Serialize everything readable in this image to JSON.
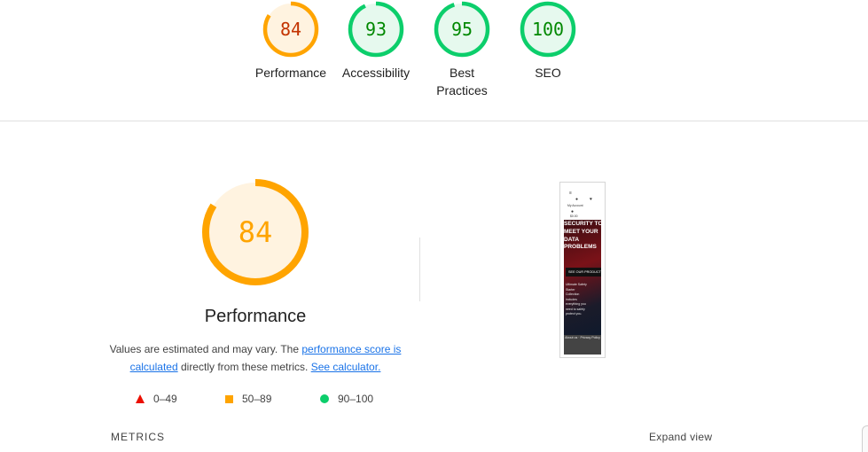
{
  "scores": [
    {
      "value": "84",
      "label": "Performance",
      "fraction": 0.84,
      "ring": "#ffa400",
      "fill": "#fff3e0",
      "text": "#c33300"
    },
    {
      "value": "93",
      "label": "Accessibility",
      "fraction": 0.93,
      "ring": "#0cce6b",
      "fill": "#e6f9ee",
      "text": "#008800"
    },
    {
      "value": "95",
      "label": "Best Practices",
      "fraction": 0.95,
      "ring": "#0cce6b",
      "fill": "#e6f9ee",
      "text": "#008800"
    },
    {
      "value": "100",
      "label": "SEO",
      "fraction": 1.0,
      "ring": "#0cce6b",
      "fill": "#e6f9ee",
      "text": "#008800"
    }
  ],
  "performance": {
    "score": "84",
    "fraction": 0.84,
    "ring": "#ffa400",
    "fill": "#fff3e0",
    "text": "#ffa400",
    "title": "Performance",
    "desc_prefix": "Values are estimated and may vary. The ",
    "link_score": "performance score is calculated",
    "desc_middle": " directly from these metrics. ",
    "link_calculator": "See calculator."
  },
  "legend": [
    {
      "icon": "triangle-icon",
      "range": "0–49",
      "color": "#eb0f00"
    },
    {
      "icon": "square-icon",
      "range": "50–89",
      "color": "#ffa400"
    },
    {
      "icon": "circle-icon",
      "range": "90–100",
      "color": "#0cce6b"
    }
  ],
  "screenshot": {
    "hero_text": "SECURITY TO MEET YOUR DATA PROBLEMS",
    "button": "SEE OUR PRODUCTS",
    "body": "Ultimate Safety Starter Collection includes everything you need to safely protect you.",
    "footer": "About us · Privacy Policy",
    "nav_a": "My Account",
    "nav_b": "$0.00"
  },
  "metrics": {
    "label": "METRICS",
    "expand": "Expand view"
  }
}
